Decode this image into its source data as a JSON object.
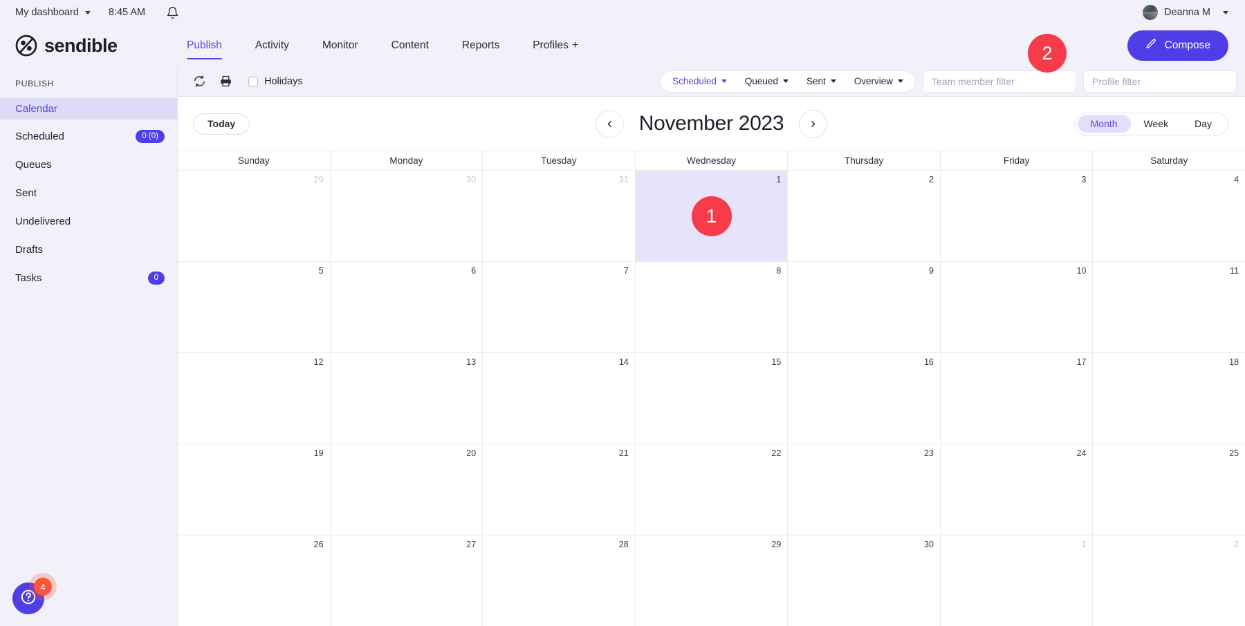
{
  "topbar": {
    "dashboard_label": "My dashboard",
    "time": "8:45 AM",
    "bell_icon": "bell-icon",
    "user_name": "Deanna M"
  },
  "brand": {
    "name": "sendible"
  },
  "nav": {
    "items": [
      {
        "label": "Publish",
        "active": true
      },
      {
        "label": "Activity",
        "active": false
      },
      {
        "label": "Monitor",
        "active": false
      },
      {
        "label": "Content",
        "active": false
      },
      {
        "label": "Reports",
        "active": false
      },
      {
        "label": "Profiles",
        "active": false,
        "plus": "+"
      }
    ]
  },
  "compose": {
    "label": "Compose",
    "icon": "pencil-icon"
  },
  "markers": {
    "compose_marker": "2",
    "today_cell_marker": "1"
  },
  "sidebar": {
    "section_title": "PUBLISH",
    "items": [
      {
        "label": "Calendar",
        "badge": null,
        "active": true
      },
      {
        "label": "Scheduled",
        "badge": "0 (0)",
        "active": false
      },
      {
        "label": "Queues",
        "badge": null,
        "active": false
      },
      {
        "label": "Sent",
        "badge": null,
        "active": false
      },
      {
        "label": "Undelivered",
        "badge": null,
        "active": false
      },
      {
        "label": "Drafts",
        "badge": null,
        "active": false
      },
      {
        "label": "Tasks",
        "badge": "0",
        "active": false
      }
    ],
    "help": {
      "icon": "question-mark-icon",
      "badge": "4"
    }
  },
  "toolbar": {
    "refresh_icon": "refresh-icon",
    "print_icon": "print-icon",
    "holidays_label": "Holidays",
    "holidays_checked": false,
    "segments": [
      {
        "label": "Scheduled",
        "active": true
      },
      {
        "label": "Queued",
        "active": false
      },
      {
        "label": "Sent",
        "active": false
      },
      {
        "label": "Overview",
        "active": false
      }
    ],
    "team_filter_placeholder": "Team member filter",
    "team_filter_value": "",
    "profile_filter_placeholder": "Profile filter",
    "profile_filter_value": ""
  },
  "calendar": {
    "today_label": "Today",
    "prev_icon": "chevron-left-icon",
    "next_icon": "chevron-right-icon",
    "title": "November 2023",
    "views": [
      {
        "label": "Month",
        "active": true
      },
      {
        "label": "Week",
        "active": false
      },
      {
        "label": "Day",
        "active": false
      }
    ],
    "day_headers": [
      "Sunday",
      "Monday",
      "Tuesday",
      "Wednesday",
      "Thursday",
      "Friday",
      "Saturday"
    ],
    "weeks": [
      [
        {
          "num": "29",
          "other": true
        },
        {
          "num": "30",
          "other": true
        },
        {
          "num": "31",
          "other": true
        },
        {
          "num": "1",
          "other": false,
          "today": true
        },
        {
          "num": "2",
          "other": false
        },
        {
          "num": "3",
          "other": false
        },
        {
          "num": "4",
          "other": false
        }
      ],
      [
        {
          "num": "5",
          "other": false
        },
        {
          "num": "6",
          "other": false
        },
        {
          "num": "7",
          "other": false
        },
        {
          "num": "8",
          "other": false
        },
        {
          "num": "9",
          "other": false
        },
        {
          "num": "10",
          "other": false
        },
        {
          "num": "11",
          "other": false
        }
      ],
      [
        {
          "num": "12",
          "other": false
        },
        {
          "num": "13",
          "other": false
        },
        {
          "num": "14",
          "other": false
        },
        {
          "num": "15",
          "other": false
        },
        {
          "num": "16",
          "other": false
        },
        {
          "num": "17",
          "other": false
        },
        {
          "num": "18",
          "other": false
        }
      ],
      [
        {
          "num": "19",
          "other": false
        },
        {
          "num": "20",
          "other": false
        },
        {
          "num": "21",
          "other": false
        },
        {
          "num": "22",
          "other": false
        },
        {
          "num": "23",
          "other": false
        },
        {
          "num": "24",
          "other": false
        },
        {
          "num": "25",
          "other": false
        }
      ],
      [
        {
          "num": "26",
          "other": false
        },
        {
          "num": "27",
          "other": false
        },
        {
          "num": "28",
          "other": false
        },
        {
          "num": "29",
          "other": false
        },
        {
          "num": "30",
          "other": false
        },
        {
          "num": "1",
          "other": true
        },
        {
          "num": "2",
          "other": true
        }
      ]
    ]
  },
  "colors": {
    "accent": "#5647e0",
    "brand_button": "#4f3ee8",
    "marker_red": "#f63b4b",
    "badge_orange": "#f9563b",
    "today_cell": "#e6e3fa",
    "chrome": "#f2f1fa"
  }
}
